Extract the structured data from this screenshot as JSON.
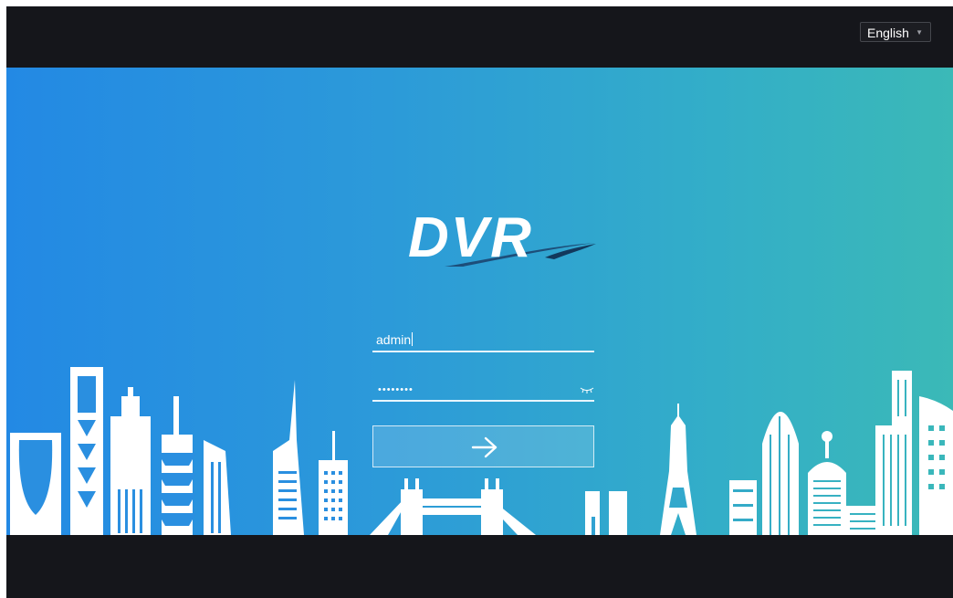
{
  "header": {
    "language_selected": "English"
  },
  "brand": {
    "logo_text": "DVR"
  },
  "login": {
    "username_value": "admin",
    "password_masked": "••••••••"
  },
  "icons": {
    "language_caret": "caret-down-icon",
    "password_visibility": "eye-closed-icon",
    "submit": "arrow-right-icon"
  },
  "colors": {
    "bar": "#15161b",
    "gradient_start": "#2389e4",
    "gradient_end": "#3bb9b7",
    "skyline": "#ffffff"
  }
}
